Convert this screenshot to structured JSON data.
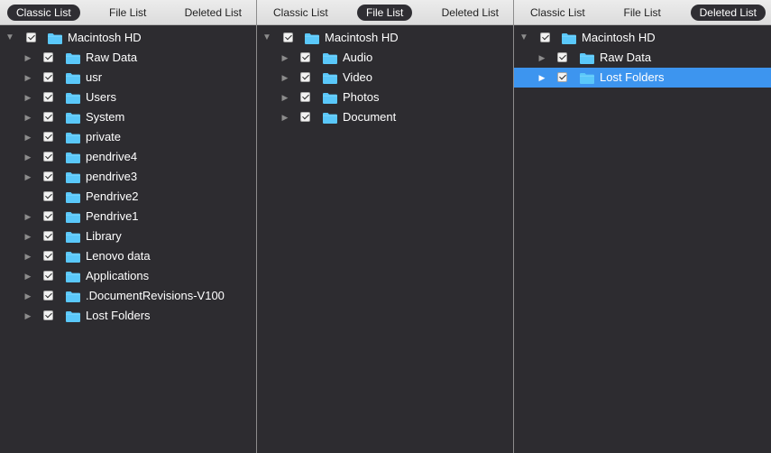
{
  "panels": [
    {
      "tabs": [
        {
          "label": "Classic List",
          "active": true
        },
        {
          "label": "File List",
          "active": false
        },
        {
          "label": "Deleted List",
          "active": false
        }
      ],
      "tree": [
        {
          "label": "Macintosh HD",
          "level": 0,
          "arrow": "expanded",
          "checked": true
        },
        {
          "label": "Raw Data",
          "level": 1,
          "arrow": "collapsed",
          "checked": true
        },
        {
          "label": "usr",
          "level": 1,
          "arrow": "collapsed",
          "checked": true
        },
        {
          "label": "Users",
          "level": 1,
          "arrow": "collapsed",
          "checked": true
        },
        {
          "label": "System",
          "level": 1,
          "arrow": "collapsed",
          "checked": true
        },
        {
          "label": "private",
          "level": 1,
          "arrow": "collapsed",
          "checked": true
        },
        {
          "label": "pendrive4",
          "level": 1,
          "arrow": "collapsed",
          "checked": true
        },
        {
          "label": "pendrive3",
          "level": 1,
          "arrow": "collapsed",
          "checked": true
        },
        {
          "label": "Pendrive2",
          "level": 1,
          "arrow": "none",
          "checked": true
        },
        {
          "label": "Pendrive1",
          "level": 1,
          "arrow": "collapsed",
          "checked": true
        },
        {
          "label": "Library",
          "level": 1,
          "arrow": "collapsed",
          "checked": true
        },
        {
          "label": "Lenovo data",
          "level": 1,
          "arrow": "collapsed",
          "checked": true
        },
        {
          "label": "Applications",
          "level": 1,
          "arrow": "collapsed",
          "checked": true
        },
        {
          "label": ".DocumentRevisions-V100",
          "level": 1,
          "arrow": "collapsed",
          "checked": true
        },
        {
          "label": "Lost Folders",
          "level": 1,
          "arrow": "collapsed",
          "checked": true
        }
      ]
    },
    {
      "tabs": [
        {
          "label": "Classic List",
          "active": false
        },
        {
          "label": "File List",
          "active": true
        },
        {
          "label": "Deleted List",
          "active": false
        }
      ],
      "tree": [
        {
          "label": "Macintosh HD",
          "level": 0,
          "arrow": "expanded",
          "checked": true
        },
        {
          "label": "Audio",
          "level": 1,
          "arrow": "collapsed",
          "checked": true
        },
        {
          "label": "Video",
          "level": 1,
          "arrow": "collapsed",
          "checked": true
        },
        {
          "label": "Photos",
          "level": 1,
          "arrow": "collapsed",
          "checked": true
        },
        {
          "label": "Document",
          "level": 1,
          "arrow": "collapsed",
          "checked": true
        }
      ]
    },
    {
      "tabs": [
        {
          "label": "Classic List",
          "active": false
        },
        {
          "label": "File List",
          "active": false
        },
        {
          "label": "Deleted List",
          "active": true
        }
      ],
      "tree": [
        {
          "label": "Macintosh HD",
          "level": 0,
          "arrow": "expanded",
          "checked": true
        },
        {
          "label": "Raw Data",
          "level": 1,
          "arrow": "collapsed",
          "checked": true
        },
        {
          "label": "Lost Folders",
          "level": 1,
          "arrow": "collapsed",
          "checked": true,
          "selected": true
        }
      ]
    }
  ],
  "icons": {
    "folder": "folder-icon",
    "checkbox": "checkbox-checked-icon",
    "expanded": "disclosure-triangle-down-icon",
    "collapsed": "disclosure-triangle-right-icon"
  },
  "colors": {
    "background": "#2d2c30",
    "tab_bar": "#e4e4e4",
    "active_tab": "#2f2e33",
    "selection": "#3d95ef",
    "folder": "#5ac8fa"
  }
}
